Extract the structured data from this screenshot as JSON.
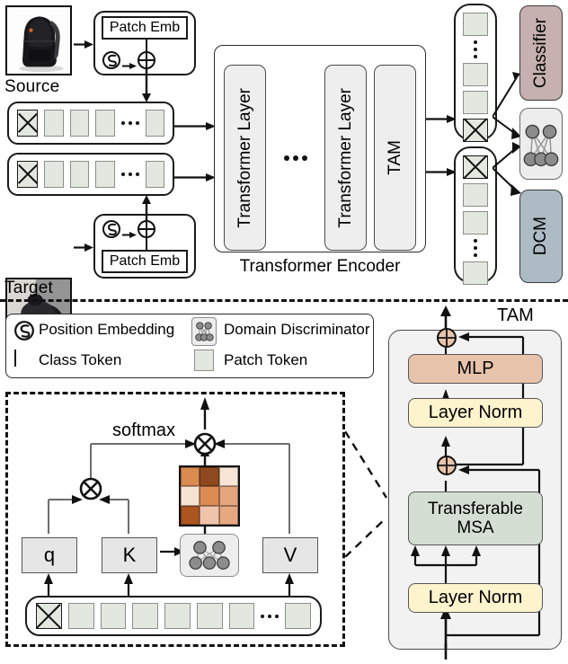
{
  "figure": {
    "title": "Transferable Vision Transformer architecture",
    "divider": "dashed-horizontal"
  },
  "colors": {
    "patch_token": "#e2e8e0",
    "classifier": "#c6b0b0",
    "dcm": "#adbcc4",
    "mlp": "#e8c3ab",
    "layer_norm": "#fdf3cd",
    "msa": "#d4ded2",
    "discriminator_bg": "#ededed",
    "discriminator_node": "#8c8c8c",
    "encoder_pill": "#eeeeee",
    "heatmap": [
      "#d98b50",
      "#8e4a1e",
      "#f6e5d4",
      "#f7e3d2",
      "#dd8b55",
      "#e5a67e",
      "#ad5520",
      "#efc4ab",
      "#e7a77f"
    ]
  },
  "top": {
    "source": {
      "caption": "Source",
      "image_alt": "black backpack on white background"
    },
    "target": {
      "caption": "Target",
      "image_alt": "dark backpack on gray floor"
    },
    "patch_emb_label": "Patch Emb",
    "position_embedding_icon": "position-embedding-icon",
    "add_icon": "plus-circle-icon",
    "source_sequence": [
      "class",
      "patch",
      "patch",
      "patch",
      "dots",
      "patch"
    ],
    "target_sequence": [
      "class",
      "patch",
      "patch",
      "patch",
      "dots",
      "patch"
    ],
    "encoder": {
      "caption": "Transformer Encoder",
      "layers": [
        "Transformer Layer",
        "Transformer Layer"
      ],
      "dots": "...",
      "tam": "TAM"
    },
    "outputs": {
      "source_tokens": [
        "patch",
        "dots",
        "patch",
        "patch",
        "class"
      ],
      "target_tokens": [
        "class",
        "patch",
        "patch",
        "dots",
        "patch"
      ],
      "classifier": "Classifier",
      "dcm": "DCM",
      "discriminator_icon": "domain-discriminator-icon"
    }
  },
  "legend": {
    "items": [
      {
        "icon": "position-embedding-icon",
        "label": "Position Embedding"
      },
      {
        "icon": "domain-discriminator-icon",
        "label": "Domain Discriminator"
      },
      {
        "icon": "class-token-icon",
        "label": "Class Token"
      },
      {
        "icon": "patch-token-icon",
        "label": "Patch Token"
      }
    ]
  },
  "attention_detail": {
    "softmax_label": "softmax",
    "q_label": "q",
    "k_label": "K",
    "v_label": "V",
    "multiply_icon": "multiply-circle-icon",
    "discriminator_icon": "domain-discriminator-icon",
    "attention_map": {
      "rows": 3,
      "cols": 3,
      "cells": [
        [
          "#d98b50",
          "#8e4a1e",
          "#f6e5d4"
        ],
        [
          "#f7e3d2",
          "#dd8b55",
          "#e5a67e"
        ],
        [
          "#ad5520",
          "#efc4ab",
          "#e7a77f"
        ]
      ]
    },
    "token_sequence": [
      "class",
      "patch",
      "patch",
      "patch",
      "patch",
      "patch",
      "patch",
      "dots",
      "patch"
    ]
  },
  "tam": {
    "title": "TAM",
    "blocks": [
      {
        "label": "MLP",
        "color": "#e8c3ab"
      },
      {
        "label": "Layer Norm",
        "color": "#fdf3cd"
      },
      {
        "label": "Transferable MSA",
        "color": "#d4ded2"
      },
      {
        "label": "Layer Norm",
        "color": "#fdf3cd"
      }
    ],
    "msa_line1": "Transferable",
    "msa_line2": "MSA",
    "residual_add_icon": "plus-circle-icon"
  }
}
